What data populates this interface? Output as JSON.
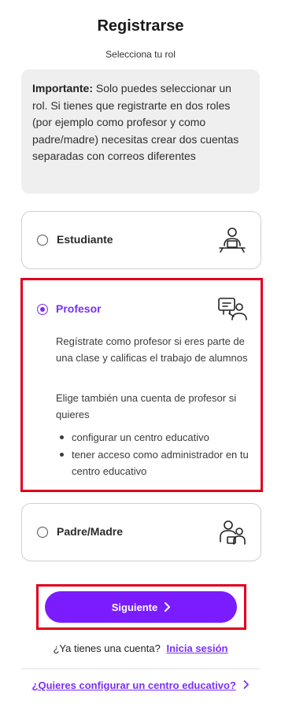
{
  "header": {
    "title": "Registrarse",
    "subtitle": "Selecciona tu rol"
  },
  "notice": {
    "bold": "Importante:",
    "text": " Solo puedes seleccionar un rol. Si tienes que registrarte en dos roles (por ejemplo como profesor y como padre/madre) necesitas crear dos cuentas separadas con correos diferentes"
  },
  "roles": [
    {
      "label": "Estudiante",
      "selected": false,
      "icon": "student-at-desk-icon"
    },
    {
      "label": "Profesor",
      "selected": true,
      "icon": "teacher-board-icon",
      "description": "Regístrate como profesor si eres parte de una clase y calificas el trabajo de alumnos",
      "extra": "Elige también una cuenta de profesor si quieres",
      "bullets": [
        "configurar un centro educativo",
        "tener acceso como administrador en tu centro educativo"
      ]
    },
    {
      "label": "Padre/Madre",
      "selected": false,
      "icon": "parent-child-icon"
    }
  ],
  "actions": {
    "next_label": "Siguiente",
    "next_icon": "chevron-right-icon"
  },
  "footer": {
    "account_question": "¿Ya tienes una cuenta?",
    "login_link": "Inicia sesión",
    "school_link": "¿Quieres configurar un centro educativo?"
  },
  "colors": {
    "accent": "#7a1cff",
    "highlight": "#e0001b",
    "notice_bg": "#efefef"
  }
}
